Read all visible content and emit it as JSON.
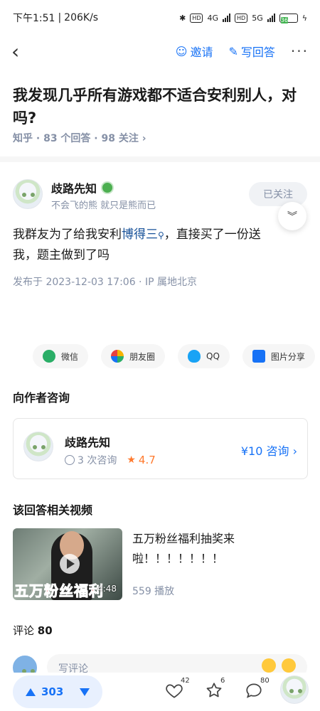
{
  "status_bar": {
    "time": "下午1:51",
    "speed": "206K/s",
    "signal_label_1": "4G",
    "signal_label_2": "5G",
    "battery": "36"
  },
  "nav": {
    "invite_label": "邀请",
    "write_answer_label": "写回答",
    "more_label": "···"
  },
  "question": {
    "title": "我发现几乎所有游戏都不适合安利别人，对吗?",
    "source": "知乎",
    "answers_count": "83 个回答",
    "follows_count": "98 关注",
    "chevron": "›"
  },
  "answer": {
    "author_name": "歧路先知",
    "author_bio": "不会飞的熊 就只是熊而已",
    "follow_label": "已关注",
    "text_before": "我群友为了给我安利",
    "link_text": "博得三",
    "text_after": "，直接买了一份送我，题主做到了吗",
    "publish_info": "发布于 2023-12-03 17:06 · IP 属地北京"
  },
  "share": [
    {
      "label": "微信",
      "icon": "wechat-icon"
    },
    {
      "label": "朋友圈",
      "icon": "moments-icon"
    },
    {
      "label": "QQ",
      "icon": "qq-icon"
    },
    {
      "label": "图片分享",
      "icon": "image-share-icon"
    }
  ],
  "consult": {
    "section_title": "向作者咨询",
    "name": "歧路先知",
    "count_text": "3 次咨询",
    "rating": "4.7",
    "price_label": "¥10 咨询 ›"
  },
  "video": {
    "section_title": "该回答相关视频",
    "caption": "五万粉丝福利",
    "duration": "4:48",
    "title": "五万粉丝福利抽奖来啦！！！！！！！",
    "plays": "559 播放"
  },
  "comments": {
    "label": "评论",
    "count": "80",
    "placeholder": "写评论"
  },
  "bottom_bar": {
    "upvotes": "303",
    "likes": "42",
    "favorites": "6",
    "comments": "80"
  },
  "colors": {
    "accent": "#1772f6",
    "muted": "#8590a6",
    "rating": "#ff7a2e"
  }
}
